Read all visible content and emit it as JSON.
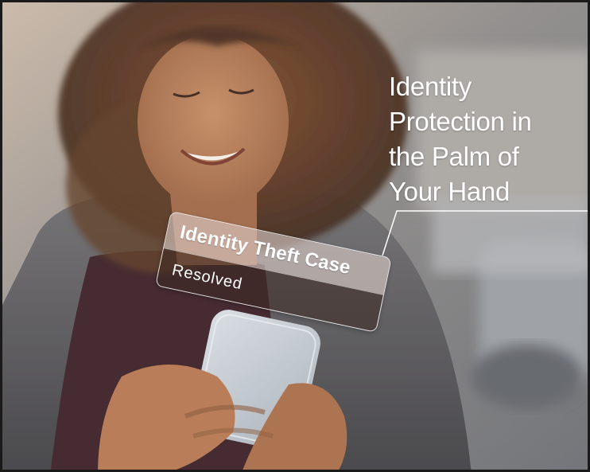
{
  "headline": {
    "lines": [
      "Identity",
      "Protection in",
      "the Palm of",
      "Your Hand"
    ]
  },
  "card": {
    "title": "Identity Theft Case",
    "status": "Resolved"
  },
  "colors": {
    "headline_text": "#ffffff",
    "card_top": "#d8c8c3",
    "card_bottom": "#3c2823",
    "frame_border": "#1a1a1a"
  }
}
